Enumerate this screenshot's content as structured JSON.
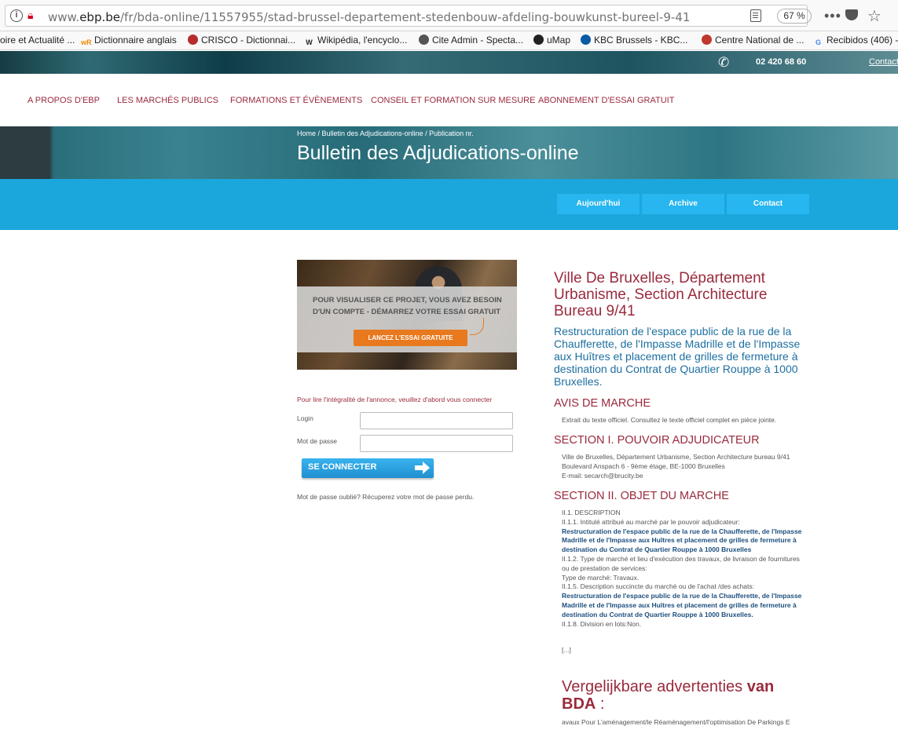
{
  "browser": {
    "url_prefix": "www.",
    "url_domain": "ebp.be",
    "url_path": "/fr/bda-online/11557955/stad-brussel-departement-stedenbouw-afdeling-bouwkunst-bureel-9-41",
    "zoom": "67 %",
    "more": "•••",
    "bookmarks": [
      {
        "label": "oire et Actualité ...",
        "icon": "",
        "color": "#999"
      },
      {
        "label": "Dictionnaire anglais",
        "icon": "wR",
        "color": "#f08a00"
      },
      {
        "label": "CRISCO - Dictionnai...",
        "icon": "",
        "color": "#b52d2d"
      },
      {
        "label": "Wikipédia, l'encyclo...",
        "icon": "W",
        "color": "#222"
      },
      {
        "label": "Cite Admin - Specta...",
        "icon": "",
        "color": "#555"
      },
      {
        "label": "uMap",
        "icon": "",
        "color": "#222"
      },
      {
        "label": "KBC Brussels - KBC...",
        "icon": "",
        "color": "#0a5aa5"
      },
      {
        "label": "Centre National de ...",
        "icon": "",
        "color": "#c0392b"
      },
      {
        "label": "Recibidos (406) -",
        "icon": "G",
        "color": "#4285f4"
      }
    ]
  },
  "topbar": {
    "phone": "02 420 68 60",
    "contact": "Contacte"
  },
  "nav": [
    "A PROPOS D'EBP",
    "LES MARCHÉS PUBLICS",
    "FORMATIONS ET ÉVÈNEMENTS",
    "CONSEIL ET FORMATION SUR MESURE",
    "ABONNEMENT D'ESSAI GRATUIT"
  ],
  "hero": {
    "breadcrumb": "Home / Bulletin des Adjudications-online / Publication nr.",
    "title": "Bulletin des Adjudications-online"
  },
  "tabs": [
    "Aujourd'hui",
    "Archive",
    "Contact"
  ],
  "promo": {
    "text": "POUR VISUALISER CE PROJET, VOUS AVEZ BESOIN D'UN COMPTE - DÉMARREZ VOTRE ESSAI GRATUIT",
    "button": "LANCEZ L'ESSAI GRATUITE"
  },
  "login": {
    "notice": "Pour lire l'intégralité de l'annonce, veuillez d'abord vous connecter",
    "login_label": "Login",
    "password_label": "Mot de passe",
    "button": "SE CONNECTER",
    "forgot": "Mot de passe oublié? Récuperez votre mot de passe perdu."
  },
  "notice": {
    "title": "Ville De Bruxelles, Département Urbanisme, Section Architecture Bureau 9/41",
    "subtitle": "Restructuration de l'espace public de la rue de la Chaufferette, de l'Impasse Madrille et de l'Impasse aux Huîtres et placement de grilles de fermeture à destination du Contrat de Quartier Rouppe à 1000 Bruxelles.",
    "avis_heading": "AVIS DE MARCHE",
    "avis_text": "Extrait du texte officiel. Consultez le texte officiel complet en pièce jointe.",
    "section1_heading": "SECTION I. POUVOIR ADJUDICATEUR",
    "section1_lines": [
      "Ville de Bruxelles, Département Urbanisme, Section Architecture bureau 9/41",
      "Boulevard Anspach 6 - 9ème étage, BE-1000 Bruxelles",
      "E-mail: secarch@brucity.be"
    ],
    "section2_heading": "SECTION II. OBJET DU MARCHE",
    "s2_l1": "II.1. DESCRIPTION",
    "s2_l2": "II.1.1. Intitulé attribué au marché par le pouvoir adjudicateur:",
    "s2_b1": "Restructuration de l'espace public de la rue de la Chaufferette, de l'Impasse Madrille et de l'Impasse aux Huîtres et placement de grilles de fermeture à destination du Contrat de Quartier Rouppe à 1000 Bruxelles",
    "s2_l3": "II.1.2. Type de marché et lieu d'exécution des travaux, de livraison de fournitures ou de prestation de services:",
    "s2_l4": "Type de marché: Travaux.",
    "s2_l5": "II.1.5. Description succincte du marché ou de l'achat /des achats:",
    "s2_b2": "Restructuration de l'espace public de la rue de la Chaufferette, de l'Impasse Madrille et de l'Impasse aux Huîtres et placement de grilles de fermeture à destination du Contrat de Quartier Rouppe à 1000 Bruxelles.",
    "s2_l6": "II.1.8. Division en lots:Non.",
    "ellipsis": "[...]"
  },
  "similar": {
    "title_a": "Vergelijkbare advertenties ",
    "title_b": "van BDA",
    "title_c": " :",
    "item": "avaux Pour L'aménagement/le Réaménagement/l'optimisation De Parkings E"
  }
}
